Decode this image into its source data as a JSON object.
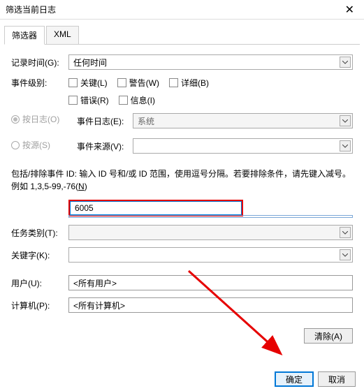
{
  "window": {
    "title": "筛选当前日志"
  },
  "tabs": {
    "filter": "筛选器",
    "xml": "XML"
  },
  "labels": {
    "log_time": "记录时间(G):",
    "event_level": "事件级别:",
    "by_log": "按日志(O)",
    "by_source": "按源(S)",
    "event_log": "事件日志(E):",
    "event_source": "事件来源(V):",
    "task_category": "任务类别(T):",
    "keywords": "关键字(K):",
    "user": "用户(U):",
    "computer": "计算机(P):"
  },
  "values": {
    "log_time": "任何时间",
    "event_log": "系统",
    "event_source": "",
    "event_id": "6005",
    "task_category": "",
    "keywords": "",
    "user": "<所有用户>",
    "computer": "<所有计算机>"
  },
  "checkboxes": {
    "critical": "关键(L)",
    "warning": "警告(W)",
    "verbose": "详细(B)",
    "error": "错误(R)",
    "info": "信息(I)"
  },
  "hint": {
    "text1": "包括/排除事件 ID: 输入 ID 号和/或 ID 范围，使用逗号分隔。若要排除条件，请先键入减号。例如 1,3,5-99,-76(",
    "underline": "N",
    "text2": ")"
  },
  "buttons": {
    "clear": "清除(A)",
    "ok": "确定",
    "cancel": "取消"
  }
}
